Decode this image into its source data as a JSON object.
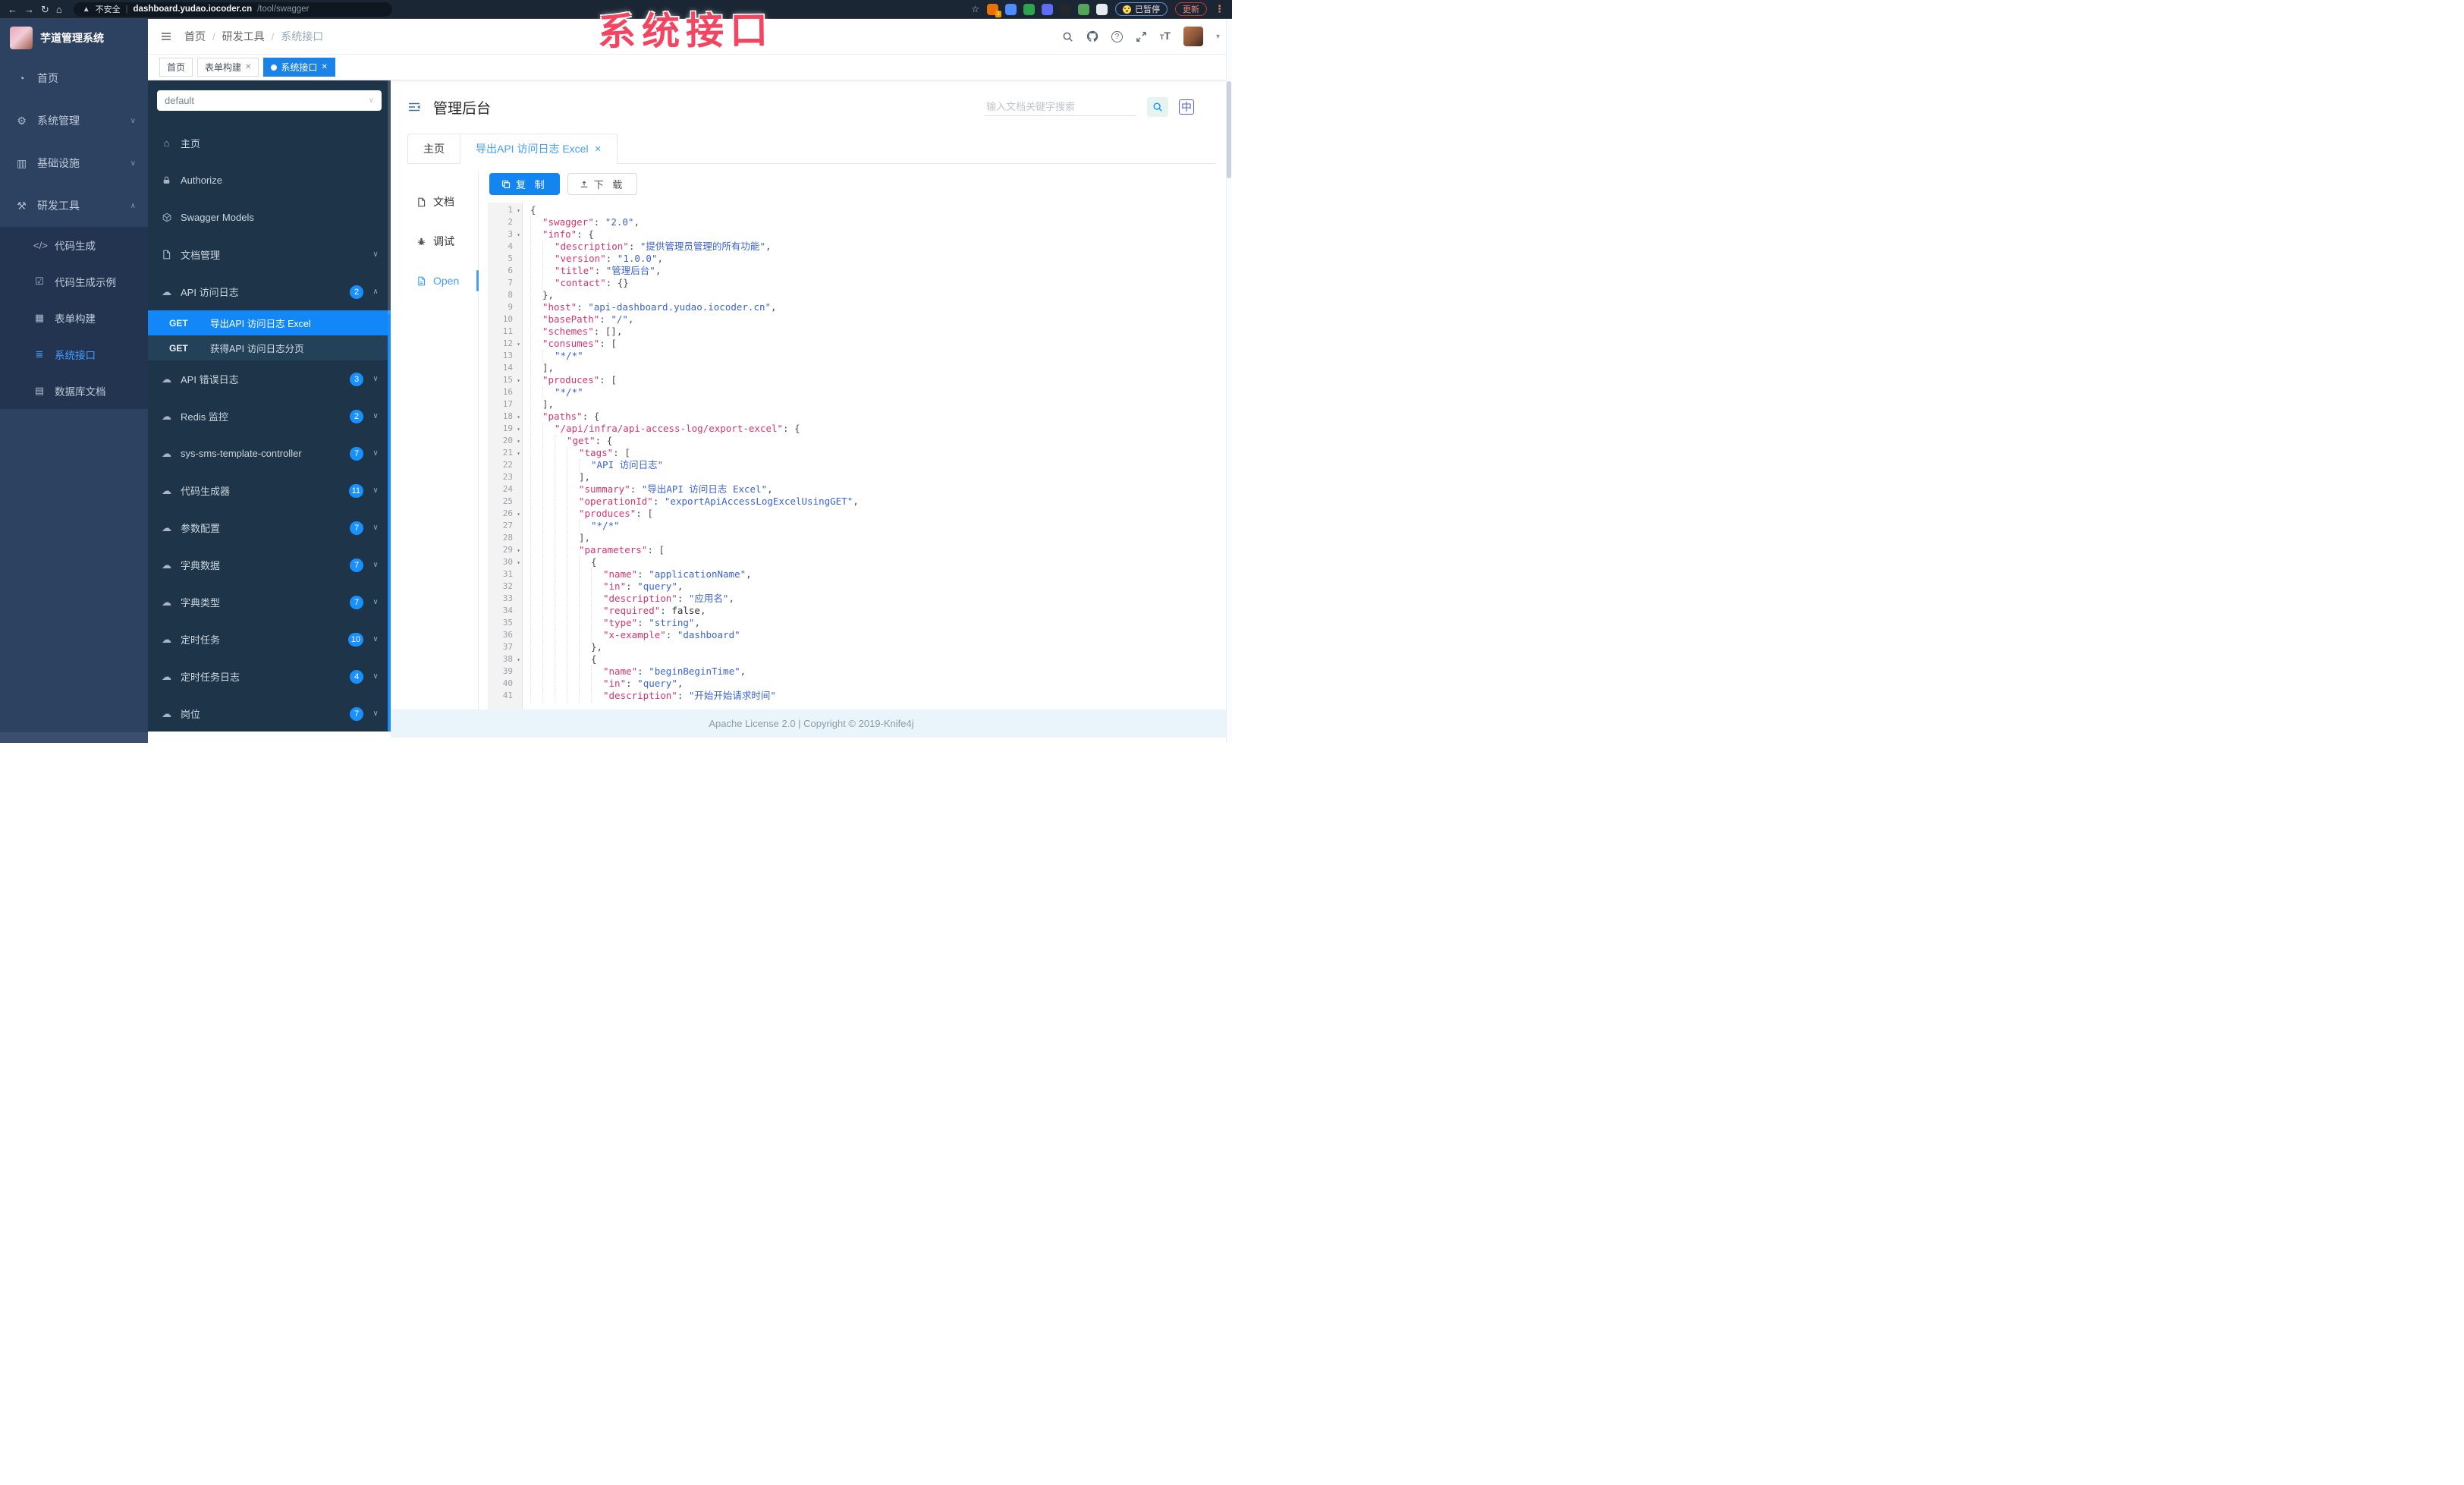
{
  "colors": {
    "accent_blue": "#1890ff",
    "element_blue": "#409eff",
    "selected_row_blue": "#1287f7",
    "active_tag_blue": "#1b82e8",
    "sidebar_bg": "#2d4160",
    "submenu_bg": "#233450",
    "swagger_panel_bg": "#1d3449",
    "annotation_red": "#f3455f",
    "footer_bg": "#e9f4fb",
    "json_key": "#d6356e",
    "json_string": "#3a63d2"
  },
  "browser": {
    "security_label": "不安全",
    "url_host": "dashboard.yudao.iocoder.cn",
    "url_path": "/tool/swagger",
    "paused_label": "已暂停",
    "update_label": "更新",
    "extensions": [
      {
        "name": "extension-orange",
        "color": "#e8710a",
        "badge": "1"
      },
      {
        "name": "extension-blue-drop",
        "color": "#4e8cff",
        "badge": ""
      },
      {
        "name": "extension-green-circle",
        "color": "#2ea44f",
        "badge": ""
      },
      {
        "name": "extension-color-grid",
        "color": "#5f6df0",
        "badge": ""
      },
      {
        "name": "extension-dark-green",
        "color": "#23282d",
        "badge": ""
      },
      {
        "name": "extension-leaf",
        "color": "#57a35a",
        "badge": ""
      },
      {
        "name": "extension-ghost",
        "color": "#e8eaed",
        "badge": ""
      }
    ]
  },
  "annotation": {
    "text": "系统接口"
  },
  "sidebar": {
    "logo_title": "芋道管理系统",
    "items": [
      {
        "label": "首页",
        "icon": "dashboard",
        "arrow": ""
      },
      {
        "label": "系统管理",
        "icon": "gear",
        "arrow": "down"
      },
      {
        "label": "基础设施",
        "icon": "infra",
        "arrow": "down"
      },
      {
        "label": "研发工具",
        "icon": "tool",
        "arrow": "up"
      }
    ],
    "subitems": [
      {
        "label": "代码生成",
        "icon": "code",
        "active": false
      },
      {
        "label": "代码生成示例",
        "icon": "example",
        "active": false
      },
      {
        "label": "表单构建",
        "icon": "form",
        "active": false
      },
      {
        "label": "系统接口",
        "icon": "api",
        "active": true
      },
      {
        "label": "数据库文档",
        "icon": "db",
        "active": false
      }
    ]
  },
  "header": {
    "breadcrumb": [
      "首页",
      "研发工具",
      "系统接口"
    ]
  },
  "tags": [
    {
      "label": "首页",
      "closable": false,
      "active": false
    },
    {
      "label": "表单构建",
      "closable": true,
      "active": false
    },
    {
      "label": "系统接口",
      "closable": true,
      "active": true
    }
  ],
  "swagger_panel": {
    "select_value": "default",
    "items": [
      {
        "label": "主页",
        "icon": "home",
        "badge": "",
        "arrow": ""
      },
      {
        "label": "Authorize",
        "icon": "lock",
        "badge": "",
        "arrow": ""
      },
      {
        "label": "Swagger Models",
        "icon": "cube",
        "badge": "",
        "arrow": ""
      },
      {
        "label": "文档管理",
        "icon": "docfile",
        "badge": "",
        "arrow": "down"
      },
      {
        "label": "API 访问日志",
        "icon": "cloud",
        "badge": "2",
        "arrow": "up",
        "children": [
          {
            "method": "GET",
            "label": "导出API 访问日志 Excel",
            "active": true
          },
          {
            "method": "GET",
            "label": "获得API 访问日志分页",
            "active": false
          }
        ]
      },
      {
        "label": "API 错误日志",
        "icon": "cloud",
        "badge": "3",
        "arrow": "down"
      },
      {
        "label": "Redis 监控",
        "icon": "cloud",
        "badge": "2",
        "arrow": "down"
      },
      {
        "label": "sys-sms-template-controller",
        "icon": "cloud",
        "badge": "7",
        "arrow": "down"
      },
      {
        "label": "代码生成器",
        "icon": "cloud",
        "badge": "11",
        "arrow": "down"
      },
      {
        "label": "参数配置",
        "icon": "cloud",
        "badge": "7",
        "arrow": "down"
      },
      {
        "label": "字典数据",
        "icon": "cloud",
        "badge": "7",
        "arrow": "down"
      },
      {
        "label": "字典类型",
        "icon": "cloud",
        "badge": "7",
        "arrow": "down"
      },
      {
        "label": "定时任务",
        "icon": "cloud",
        "badge": "10",
        "arrow": "down"
      },
      {
        "label": "定时任务日志",
        "icon": "cloud",
        "badge": "4",
        "arrow": "down"
      },
      {
        "label": "岗位",
        "icon": "cloud",
        "badge": "7",
        "arrow": "down"
      }
    ]
  },
  "content": {
    "title": "管理后台",
    "search_placeholder": "输入文档关键字搜索",
    "tabs": [
      {
        "label": "主页",
        "closable": false,
        "active": false
      },
      {
        "label": "导出API 访问日志 Excel",
        "closable": true,
        "active": true
      }
    ],
    "doc_tabs": [
      {
        "label": "文档",
        "icon": "docfile",
        "active": false
      },
      {
        "label": "调试",
        "icon": "bug",
        "active": false
      },
      {
        "label": "Open",
        "icon": "openfile",
        "active": true
      }
    ],
    "copy_label": "复 制",
    "download_label": "下 载",
    "footer": "Apache License 2.0 | Copyright © 2019-Knife4j"
  },
  "code": {
    "lines": [
      {
        "n": 1,
        "i": 0,
        "f": true,
        "t": [
          [
            "p",
            "{"
          ]
        ]
      },
      {
        "n": 2,
        "i": 1,
        "f": false,
        "t": [
          [
            "k",
            "\"swagger\""
          ],
          [
            "p",
            ": "
          ],
          [
            "s",
            "\"2.0\""
          ],
          [
            "p",
            ","
          ]
        ]
      },
      {
        "n": 3,
        "i": 1,
        "f": true,
        "t": [
          [
            "k",
            "\"info\""
          ],
          [
            "p",
            ": {"
          ]
        ]
      },
      {
        "n": 4,
        "i": 2,
        "f": false,
        "t": [
          [
            "k",
            "\"description\""
          ],
          [
            "p",
            ": "
          ],
          [
            "s",
            "\"提供管理员管理的所有功能\""
          ],
          [
            "p",
            ","
          ]
        ]
      },
      {
        "n": 5,
        "i": 2,
        "f": false,
        "t": [
          [
            "k",
            "\"version\""
          ],
          [
            "p",
            ": "
          ],
          [
            "s",
            "\"1.0.0\""
          ],
          [
            "p",
            ","
          ]
        ]
      },
      {
        "n": 6,
        "i": 2,
        "f": false,
        "t": [
          [
            "k",
            "\"title\""
          ],
          [
            "p",
            ": "
          ],
          [
            "s",
            "\"管理后台\""
          ],
          [
            "p",
            ","
          ]
        ]
      },
      {
        "n": 7,
        "i": 2,
        "f": false,
        "t": [
          [
            "k",
            "\"contact\""
          ],
          [
            "p",
            ": {}"
          ]
        ]
      },
      {
        "n": 8,
        "i": 1,
        "f": false,
        "t": [
          [
            "p",
            "},"
          ]
        ]
      },
      {
        "n": 9,
        "i": 1,
        "f": false,
        "t": [
          [
            "k",
            "\"host\""
          ],
          [
            "p",
            ": "
          ],
          [
            "s",
            "\"api-dashboard.yudao.iocoder.cn\""
          ],
          [
            "p",
            ","
          ]
        ]
      },
      {
        "n": 10,
        "i": 1,
        "f": false,
        "t": [
          [
            "k",
            "\"basePath\""
          ],
          [
            "p",
            ": "
          ],
          [
            "s",
            "\"/\""
          ],
          [
            "p",
            ","
          ]
        ]
      },
      {
        "n": 11,
        "i": 1,
        "f": false,
        "t": [
          [
            "k",
            "\"schemes\""
          ],
          [
            "p",
            ": [],"
          ]
        ]
      },
      {
        "n": 12,
        "i": 1,
        "f": true,
        "t": [
          [
            "k",
            "\"consumes\""
          ],
          [
            "p",
            ": ["
          ]
        ]
      },
      {
        "n": 13,
        "i": 2,
        "f": false,
        "t": [
          [
            "s",
            "\"*/*\""
          ]
        ]
      },
      {
        "n": 14,
        "i": 1,
        "f": false,
        "t": [
          [
            "p",
            "],"
          ]
        ]
      },
      {
        "n": 15,
        "i": 1,
        "f": true,
        "t": [
          [
            "k",
            "\"produces\""
          ],
          [
            "p",
            ": ["
          ]
        ]
      },
      {
        "n": 16,
        "i": 2,
        "f": false,
        "t": [
          [
            "s",
            "\"*/*\""
          ]
        ]
      },
      {
        "n": 17,
        "i": 1,
        "f": false,
        "t": [
          [
            "p",
            "],"
          ]
        ]
      },
      {
        "n": 18,
        "i": 1,
        "f": true,
        "t": [
          [
            "k",
            "\"paths\""
          ],
          [
            "p",
            ": {"
          ]
        ]
      },
      {
        "n": 19,
        "i": 2,
        "f": true,
        "t": [
          [
            "k",
            "\"/api/infra/api-access-log/export-excel\""
          ],
          [
            "p",
            ": {"
          ]
        ]
      },
      {
        "n": 20,
        "i": 3,
        "f": true,
        "t": [
          [
            "k",
            "\"get\""
          ],
          [
            "p",
            ": {"
          ]
        ]
      },
      {
        "n": 21,
        "i": 4,
        "f": true,
        "t": [
          [
            "k",
            "\"tags\""
          ],
          [
            "p",
            ": ["
          ]
        ]
      },
      {
        "n": 22,
        "i": 5,
        "f": false,
        "t": [
          [
            "s",
            "\"API 访问日志\""
          ]
        ]
      },
      {
        "n": 23,
        "i": 4,
        "f": false,
        "t": [
          [
            "p",
            "],"
          ]
        ]
      },
      {
        "n": 24,
        "i": 4,
        "f": false,
        "t": [
          [
            "k",
            "\"summary\""
          ],
          [
            "p",
            ": "
          ],
          [
            "s",
            "\"导出API 访问日志 Excel\""
          ],
          [
            "p",
            ","
          ]
        ]
      },
      {
        "n": 25,
        "i": 4,
        "f": false,
        "t": [
          [
            "k",
            "\"operationId\""
          ],
          [
            "p",
            ": "
          ],
          [
            "s",
            "\"exportApiAccessLogExcelUsingGET\""
          ],
          [
            "p",
            ","
          ]
        ]
      },
      {
        "n": 26,
        "i": 4,
        "f": true,
        "t": [
          [
            "k",
            "\"produces\""
          ],
          [
            "p",
            ": ["
          ]
        ]
      },
      {
        "n": 27,
        "i": 5,
        "f": false,
        "t": [
          [
            "s",
            "\"*/*\""
          ]
        ]
      },
      {
        "n": 28,
        "i": 4,
        "f": false,
        "t": [
          [
            "p",
            "],"
          ]
        ]
      },
      {
        "n": 29,
        "i": 4,
        "f": true,
        "t": [
          [
            "k",
            "\"parameters\""
          ],
          [
            "p",
            ": ["
          ]
        ]
      },
      {
        "n": 30,
        "i": 5,
        "f": true,
        "t": [
          [
            "p",
            "{"
          ]
        ]
      },
      {
        "n": 31,
        "i": 6,
        "f": false,
        "t": [
          [
            "k",
            "\"name\""
          ],
          [
            "p",
            ": "
          ],
          [
            "s",
            "\"applicationName\""
          ],
          [
            "p",
            ","
          ]
        ]
      },
      {
        "n": 32,
        "i": 6,
        "f": false,
        "t": [
          [
            "k",
            "\"in\""
          ],
          [
            "p",
            ": "
          ],
          [
            "s",
            "\"query\""
          ],
          [
            "p",
            ","
          ]
        ]
      },
      {
        "n": 33,
        "i": 6,
        "f": false,
        "t": [
          [
            "k",
            "\"description\""
          ],
          [
            "p",
            ": "
          ],
          [
            "s",
            "\"应用名\""
          ],
          [
            "p",
            ","
          ]
        ]
      },
      {
        "n": 34,
        "i": 6,
        "f": false,
        "t": [
          [
            "k",
            "\"required\""
          ],
          [
            "p",
            ": "
          ],
          [
            "b",
            "false"
          ],
          [
            "p",
            ","
          ]
        ]
      },
      {
        "n": 35,
        "i": 6,
        "f": false,
        "t": [
          [
            "k",
            "\"type\""
          ],
          [
            "p",
            ": "
          ],
          [
            "s",
            "\"string\""
          ],
          [
            "p",
            ","
          ]
        ]
      },
      {
        "n": 36,
        "i": 6,
        "f": false,
        "t": [
          [
            "k",
            "\"x-example\""
          ],
          [
            "p",
            ": "
          ],
          [
            "s",
            "\"dashboard\""
          ]
        ]
      },
      {
        "n": 37,
        "i": 5,
        "f": false,
        "t": [
          [
            "p",
            "},"
          ]
        ]
      },
      {
        "n": 38,
        "i": 5,
        "f": true,
        "t": [
          [
            "p",
            "{"
          ]
        ]
      },
      {
        "n": 39,
        "i": 6,
        "f": false,
        "t": [
          [
            "k",
            "\"name\""
          ],
          [
            "p",
            ": "
          ],
          [
            "s",
            "\"beginBeginTime\""
          ],
          [
            "p",
            ","
          ]
        ]
      },
      {
        "n": 40,
        "i": 6,
        "f": false,
        "t": [
          [
            "k",
            "\"in\""
          ],
          [
            "p",
            ": "
          ],
          [
            "s",
            "\"query\""
          ],
          [
            "p",
            ","
          ]
        ]
      },
      {
        "n": 41,
        "i": 6,
        "f": false,
        "t": [
          [
            "k",
            "\"description\""
          ],
          [
            "p",
            ": "
          ],
          [
            "s",
            "\"开始开始请求时间\""
          ]
        ]
      }
    ]
  }
}
